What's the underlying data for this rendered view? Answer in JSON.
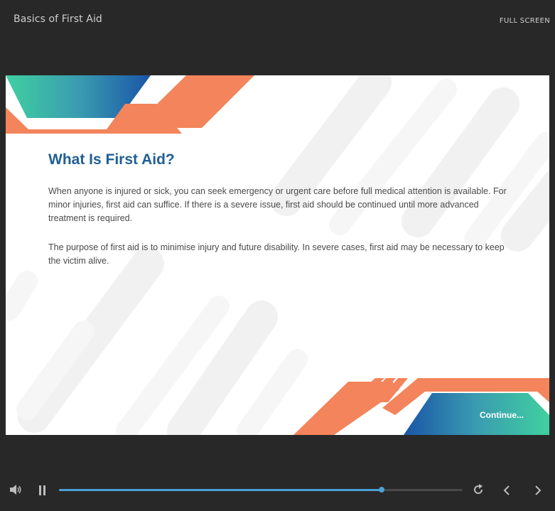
{
  "header": {
    "course_title": "Basics of First Aid",
    "fullscreen_label": "FULL SCREEN"
  },
  "slide": {
    "heading": "What Is First Aid?",
    "paragraphs": [
      "When anyone is injured or sick, you can seek emergency or urgent care before full medical attention is available. For minor injuries, first aid can suffice. If there is a severe issue, first aid should be continued until more advanced treatment is required.",
      "The purpose of first aid is to minimise injury and future disability. In severe cases, first aid may be necessary to keep the victim alive."
    ],
    "continue_label": "Continue..."
  },
  "player": {
    "progress_percent": 80,
    "icons": {
      "volume": "volume-icon",
      "pause": "pause-icon",
      "replay": "replay-icon",
      "previous": "chevron-left-icon",
      "next": "chevron-right-icon"
    }
  },
  "colors": {
    "background": "#282828",
    "accent_orange": "#f3845b",
    "accent_teal": "#40d0a0",
    "accent_blue": "#1a5aa8",
    "heading_blue": "#1f5f95",
    "progress_blue": "#4ba0d4"
  }
}
